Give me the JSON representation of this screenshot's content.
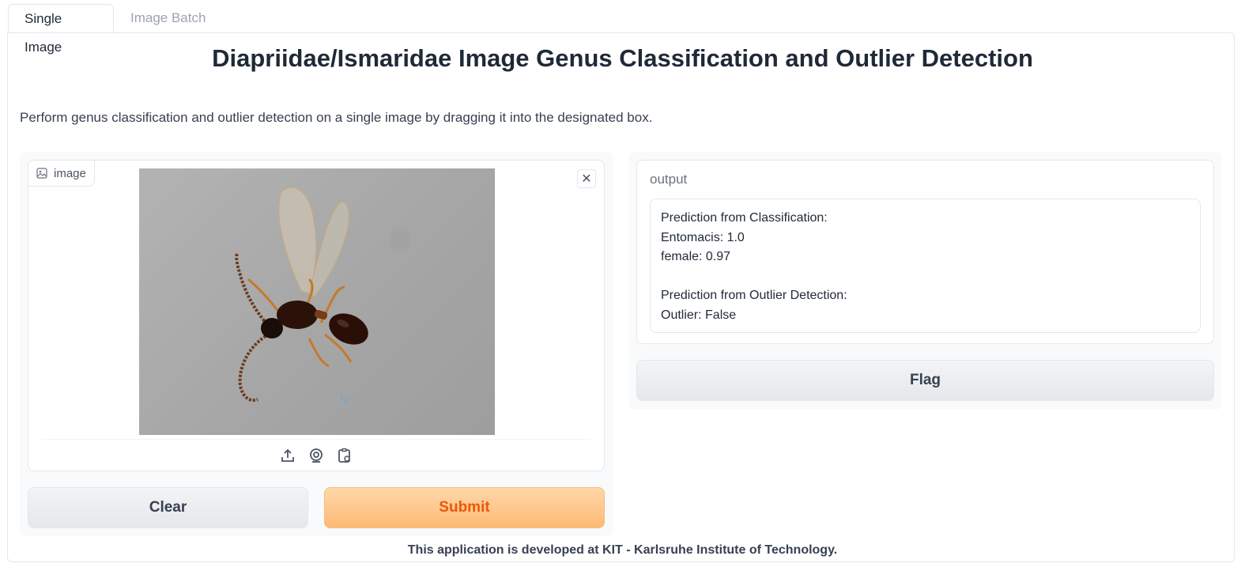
{
  "tabs": [
    {
      "label": "Single Image",
      "active": true
    },
    {
      "label": "Image Batch",
      "active": false
    }
  ],
  "title": "Diapriidae/Ismaridae Image Genus Classification and Outlier Detection",
  "description": "Perform genus classification and outlier detection on a single image by dragging it into the designated box.",
  "image_input": {
    "label": "image",
    "icons": [
      "image-icon",
      "close-icon",
      "upload-icon",
      "webcam-icon",
      "clipboard-icon"
    ]
  },
  "buttons": {
    "clear": "Clear",
    "submit": "Submit",
    "flag": "Flag"
  },
  "output": {
    "label": "output",
    "lines": [
      "Prediction from Classification:",
      "Entomacis: 1.0",
      "female: 0.97",
      "",
      "Prediction from Outlier Detection:",
      "Outlier: False"
    ]
  },
  "footer": "This application is developed at KIT - Karlsruhe Institute of Technology.",
  "colors": {
    "accent_orange": "#ea580c",
    "submit_bg": "#fdba74",
    "border": "#e5e7eb"
  }
}
